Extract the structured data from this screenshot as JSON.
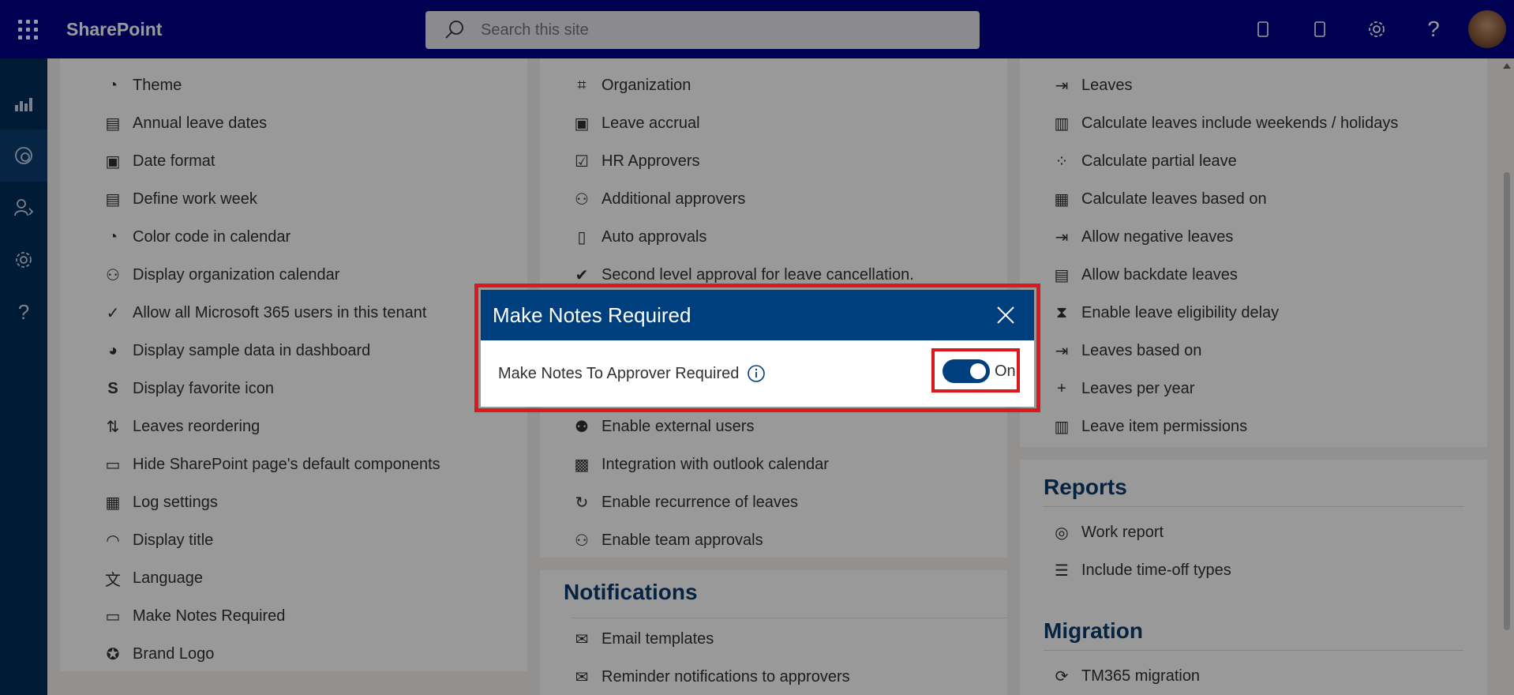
{
  "suite": {
    "app_name": "SharePoint",
    "search_placeholder": "Search this site"
  },
  "columns": {
    "left": [
      {
        "label": "Theme",
        "icon": "palette-icon"
      },
      {
        "label": "Annual leave dates",
        "icon": "calendar-box-icon"
      },
      {
        "label": "Date format",
        "icon": "calendar-clock-icon"
      },
      {
        "label": "Define work week",
        "icon": "calendar-box-icon"
      },
      {
        "label": "Color code in calendar",
        "icon": "palette-icon"
      },
      {
        "label": "Display organization calendar",
        "icon": "people-icon"
      },
      {
        "label": "Allow all Microsoft 365 users in this tenant",
        "icon": "user-check-icon"
      },
      {
        "label": "Display sample data in dashboard",
        "icon": "gauge-icon"
      },
      {
        "label": "Display favorite icon",
        "icon": "sharepoint-icon"
      },
      {
        "label": "Leaves reordering",
        "icon": "sort-icon"
      },
      {
        "label": "Hide SharePoint page's default components",
        "icon": "page-icon"
      },
      {
        "label": "Log settings",
        "icon": "doc-search-icon"
      },
      {
        "label": "Display title",
        "icon": "eye-icon"
      },
      {
        "label": "Language",
        "icon": "translate-icon"
      },
      {
        "label": "Make Notes Required",
        "icon": "note-icon"
      },
      {
        "label": "Brand Logo",
        "icon": "badge-icon"
      }
    ],
    "middle": [
      {
        "label": "Organization",
        "icon": "org-icon"
      },
      {
        "label": "Leave accrual",
        "icon": "accrual-icon"
      },
      {
        "label": "HR Approvers",
        "icon": "approvers-icon"
      },
      {
        "label": "Additional approvers",
        "icon": "people-icon"
      },
      {
        "label": "Auto approvals",
        "icon": "clipboard-icon"
      },
      {
        "label": "Second level approval for leave cancellation.",
        "icon": "doc-check-icon"
      },
      {
        "label": "",
        "icon": ""
      },
      {
        "label": "",
        "icon": ""
      },
      {
        "label": "",
        "icon": ""
      },
      {
        "label": "Enable external users",
        "icon": "external-users-icon"
      },
      {
        "label": "Integration with outlook calendar",
        "icon": "outlook-icon"
      },
      {
        "label": "Enable recurrence of leaves",
        "icon": "recurrence-icon"
      },
      {
        "label": "Enable team approvals",
        "icon": "team-icon"
      }
    ],
    "notifications_title": "Notifications",
    "notifications": [
      {
        "label": "Email templates",
        "icon": "mail-icon"
      },
      {
        "label": "Reminder notifications to approvers",
        "icon": "mail-clock-icon"
      }
    ],
    "right": [
      {
        "label": "Leaves",
        "icon": "leave-icon"
      },
      {
        "label": "Calculate leaves include weekends / holidays",
        "icon": "columns-icon"
      },
      {
        "label": "Calculate partial leave",
        "icon": "partial-icon"
      },
      {
        "label": "Calculate leaves based on",
        "icon": "calculator-icon"
      },
      {
        "label": "Allow negative leaves",
        "icon": "leave-icon"
      },
      {
        "label": "Allow backdate leaves",
        "icon": "money-icon"
      },
      {
        "label": "Enable leave eligibility delay",
        "icon": "hourglass-icon"
      },
      {
        "label": "Leaves based on",
        "icon": "leave-icon"
      },
      {
        "label": "Leaves per year",
        "icon": "plus-icon"
      },
      {
        "label": "Leave item permissions",
        "icon": "columns-icon"
      }
    ],
    "reports_title": "Reports",
    "reports": [
      {
        "label": "Work report",
        "icon": "report-icon"
      },
      {
        "label": "Include time-off types",
        "icon": "checklist-icon"
      }
    ],
    "migration_title": "Migration",
    "migration": [
      {
        "label": "TM365 migration",
        "icon": "migration-icon"
      }
    ]
  },
  "dialog": {
    "title": "Make Notes Required",
    "field_label": "Make Notes To Approver Required",
    "toggle_state": "On",
    "toggle_on": true
  },
  "colors": {
    "suitebar": "#00008b",
    "leftrail": "#002d5a",
    "dialog_header": "#003f7d",
    "highlight": "#d9191c",
    "section_title": "#0b3b6e"
  }
}
